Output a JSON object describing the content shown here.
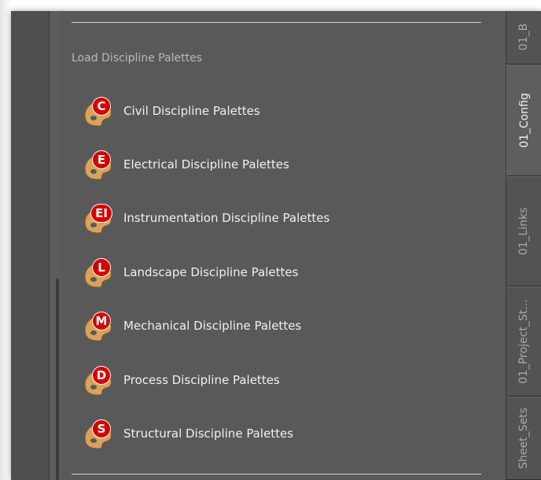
{
  "section": {
    "title": "Load Discipline Palettes"
  },
  "items": [
    {
      "letter": "C",
      "label": "Civil Discipline Palettes"
    },
    {
      "letter": "E",
      "label": "Electrical Discipline Palettes"
    },
    {
      "letter": "EI",
      "label": "Instrumentation Discipline Palettes"
    },
    {
      "letter": "L",
      "label": "Landscape Discipline Palettes"
    },
    {
      "letter": "M",
      "label": "Mechanical Discipline Palettes"
    },
    {
      "letter": "D",
      "label": "Process Discipline Palettes"
    },
    {
      "letter": "S",
      "label": "Structural Discipline Palettes"
    }
  ],
  "tabs": [
    {
      "label": "01_B",
      "active": false
    },
    {
      "label": "01_Config",
      "active": true
    },
    {
      "label": "01_Links",
      "active": false
    },
    {
      "label": "01_Project_St...",
      "active": false
    },
    {
      "label": "Sheet_Sets",
      "active": false
    }
  ],
  "colors": {
    "panel_bg": "#595959",
    "badge_red": "#d40000",
    "palette_tan": "#d9a35e",
    "text_light": "#f0f0f0",
    "section_text": "#b9b9b9"
  },
  "icons": {
    "palette_item": "paint-palette-icon"
  }
}
